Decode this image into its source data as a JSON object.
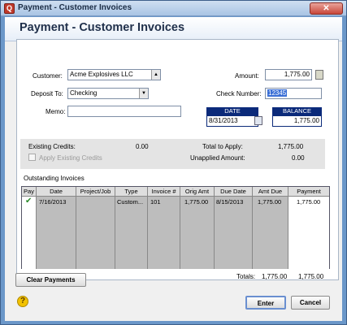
{
  "window": {
    "title": "Payment - Customer Invoices",
    "close_glyph": "✕",
    "app_icon_glyph": "Q"
  },
  "form": {
    "title": "Payment - Customer Invoices"
  },
  "customer": {
    "label": "Customer:",
    "value": "Acme Explosives LLC"
  },
  "deposit": {
    "label": "Deposit To:",
    "value": "Checking"
  },
  "memo": {
    "label": "Memo:",
    "value": ""
  },
  "amount": {
    "label": "Amount:",
    "value": "1,775.00"
  },
  "check_number": {
    "label": "Check Number:",
    "value": "12345"
  },
  "date_box": {
    "header": "DATE",
    "value": "8/31/2013"
  },
  "balance_box": {
    "header": "BALANCE",
    "value": "1,775.00"
  },
  "credits": {
    "existing_label": "Existing Credits:",
    "existing_value": "0.00",
    "apply_label": "Apply Existing Credits",
    "total_label": "Total to Apply:",
    "total_value": "1,775.00",
    "unapplied_label": "Unapplied Amount:",
    "unapplied_value": "0.00"
  },
  "invoices": {
    "section_label": "Outstanding Invoices",
    "columns": [
      "Pay",
      "Date",
      "Project/Job",
      "Type",
      "Invoice #",
      "Orig Amt",
      "Due Date",
      "Amt Due",
      "Payment"
    ],
    "rows": [
      {
        "pay": "✔",
        "date": "7/16/2013",
        "project": "",
        "type": "Custom...",
        "invoice": "101",
        "orig_amt": "1,775.00",
        "due_date": "8/15/2013",
        "amt_due": "1,775.00",
        "payment": "1,775.00"
      }
    ],
    "totals_label": "Totals:",
    "totals_amt_due": "1,775.00",
    "totals_payment": "1,775.00"
  },
  "buttons": {
    "clear": "Clear Payments",
    "enter": "Enter",
    "cancel": "Cancel"
  },
  "help_glyph": "?",
  "colors": {
    "title_bar": "#a9c4e4",
    "box_header": "#0b2a7a",
    "check_mark": "#2a8a2a",
    "selection": "#3a6fd6"
  }
}
